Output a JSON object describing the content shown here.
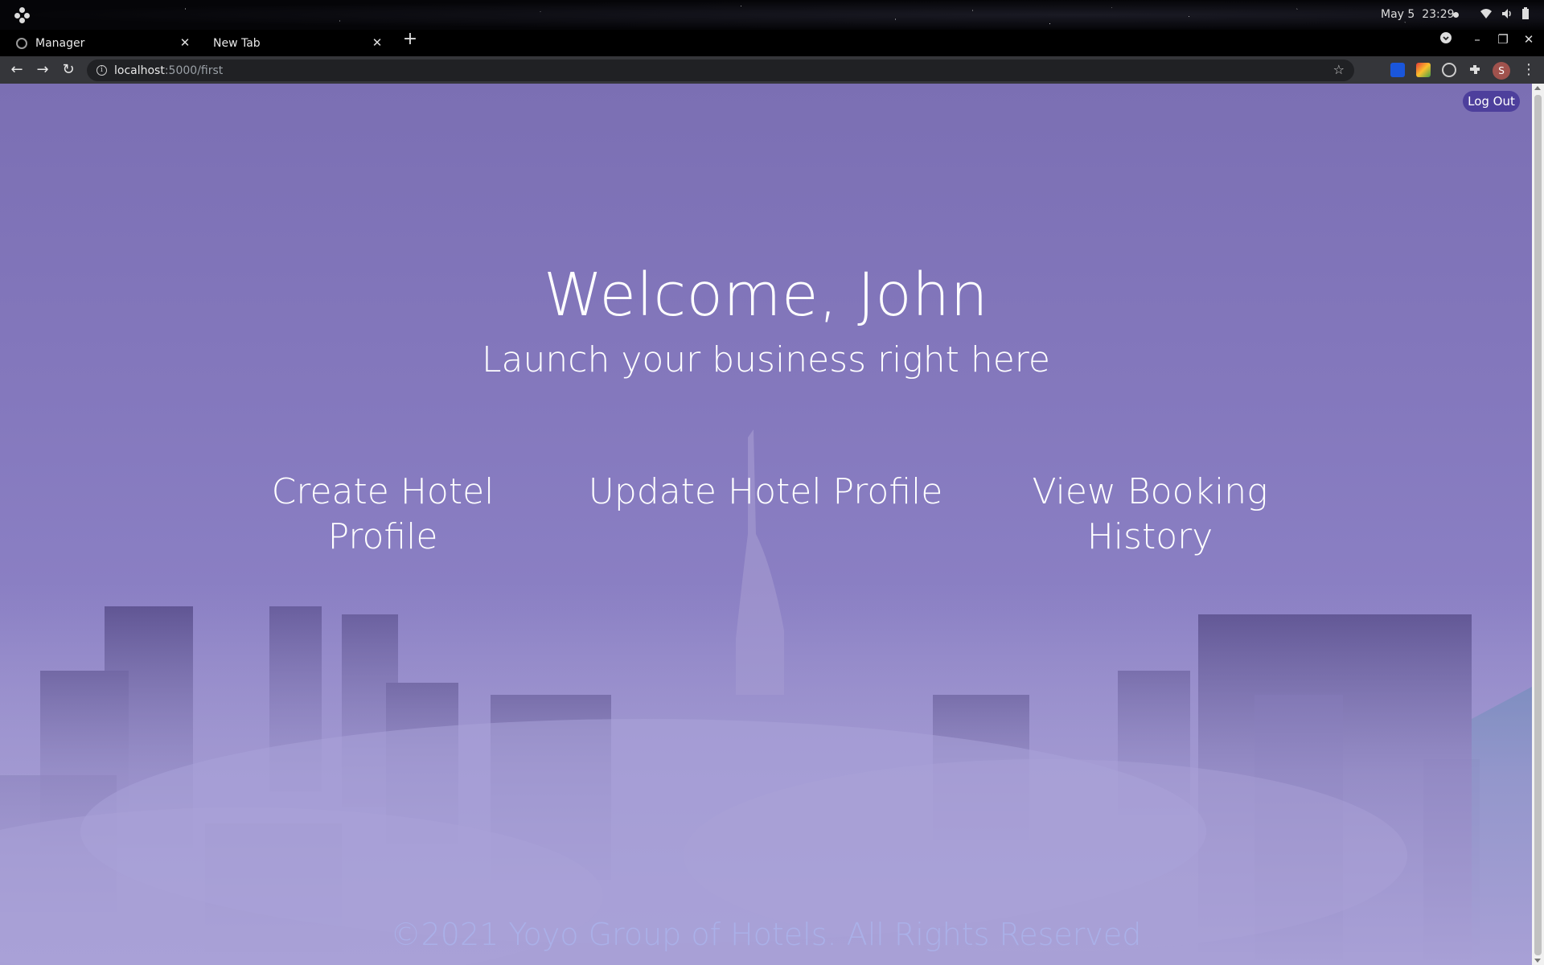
{
  "os": {
    "date": "May 5",
    "time": "23:29"
  },
  "browser": {
    "tabs": [
      {
        "title": "Manager"
      },
      {
        "title": "New Tab"
      }
    ],
    "url_host": "localhost",
    "url_path": ":5000/first"
  },
  "page": {
    "logout_label": "Log Out",
    "welcome": "Welcome, John",
    "tagline": "Launch your business right here",
    "actions": {
      "create": "Create Hotel Profile",
      "update": "Update Hotel Profile",
      "history_line1": "View Booking",
      "history_line2": "History"
    },
    "footer": "©2021 Yoyo Group of Hotels. All Rights Reserved"
  },
  "colors": {
    "page_background": "#8478bd",
    "logout_button": "#4d3f9c",
    "footer_text": "#aab0e8"
  }
}
